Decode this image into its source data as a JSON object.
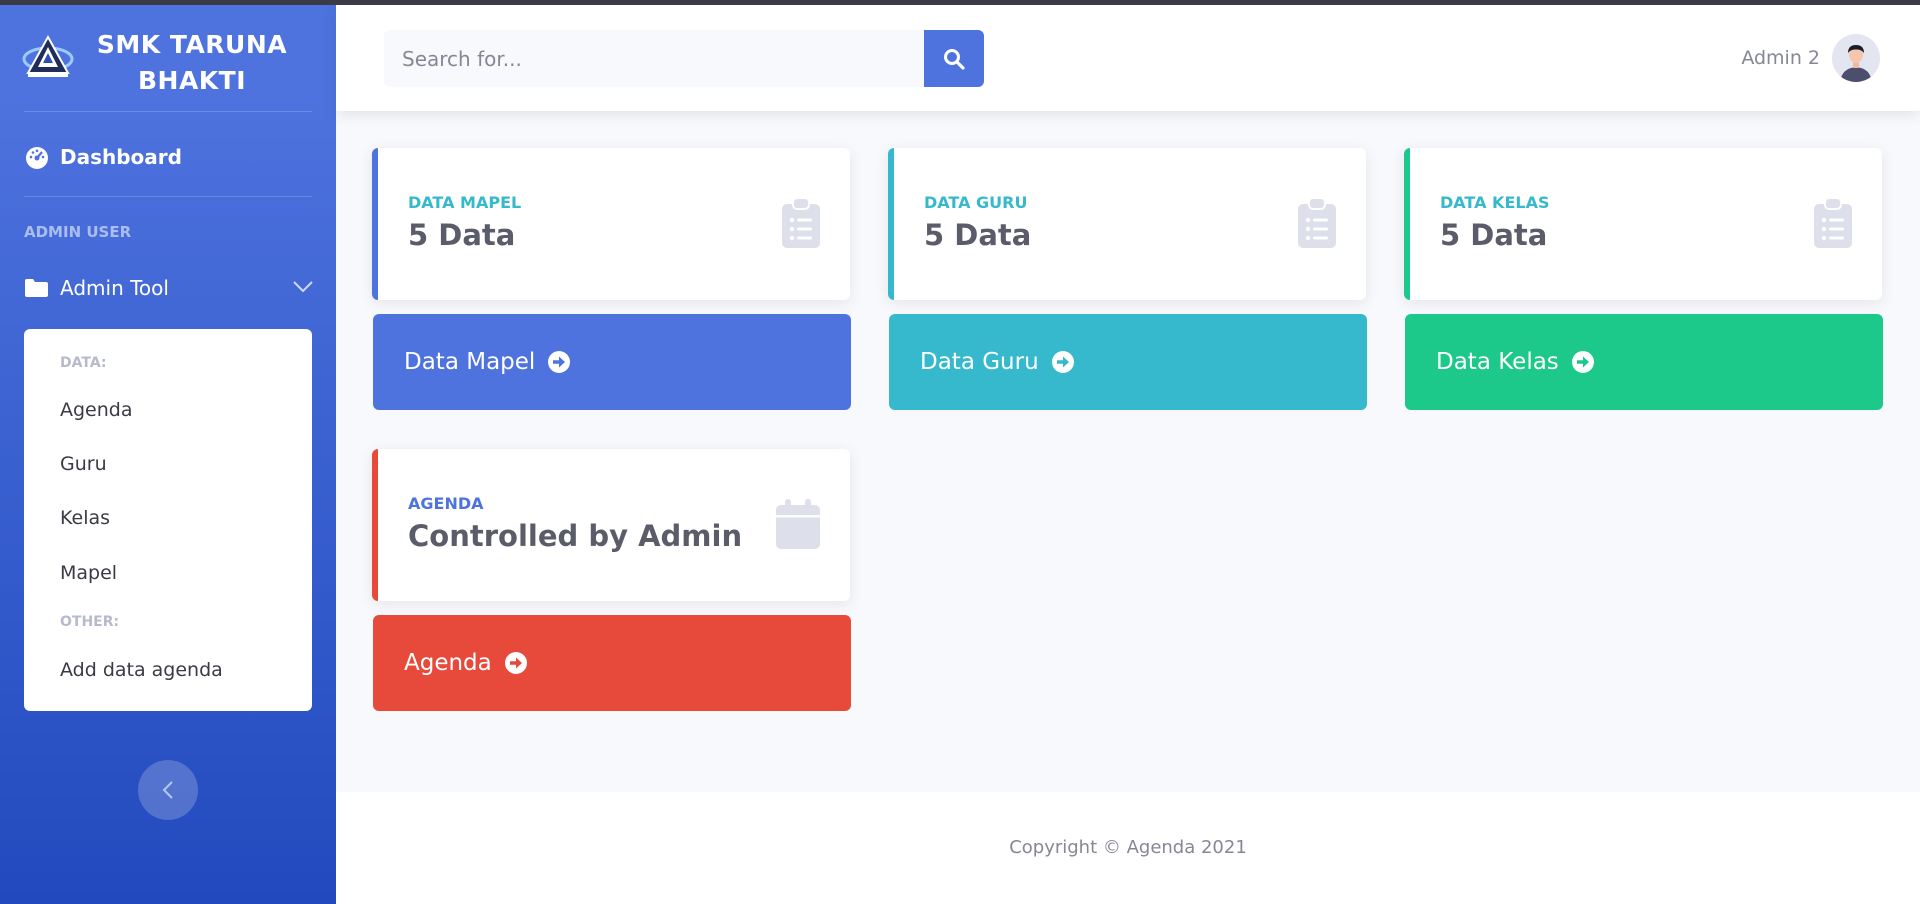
{
  "brand": {
    "name": "SMK TARUNA BHAKTI"
  },
  "sidebar": {
    "dashboard_label": "Dashboard",
    "heading": "ADMIN USER",
    "admin_tool_label": "Admin Tool",
    "submenu": {
      "data_heading": "DATA:",
      "items": [
        "Agenda",
        "Guru",
        "Kelas",
        "Mapel"
      ],
      "other_heading": "OTHER:",
      "other_items": [
        "Add data agenda"
      ]
    }
  },
  "topbar": {
    "search_placeholder": "Search for...",
    "user_name": "Admin 2"
  },
  "cards": [
    {
      "label": "DATA MAPEL",
      "value": "5 Data",
      "button": "Data Mapel",
      "accent": "#4e73df",
      "label_color": "#36b9cc",
      "icon": "clipboard-list-icon"
    },
    {
      "label": "DATA GURU",
      "value": "5 Data",
      "button": "Data Guru",
      "accent": "#36b9cc",
      "label_color": "#36b9cc",
      "icon": "clipboard-list-icon"
    },
    {
      "label": "DATA KELAS",
      "value": "5 Data",
      "button": "Data Kelas",
      "accent": "#1cc88a",
      "label_color": "#36b9cc",
      "icon": "clipboard-list-icon"
    },
    {
      "label": "AGENDA",
      "value": "Controlled by Admin",
      "button": "Agenda",
      "accent": "#e74a3b",
      "label_color": "#4e73df",
      "icon": "calendar-icon"
    }
  ],
  "footer": {
    "text": "Copyright © Agenda 2021"
  }
}
